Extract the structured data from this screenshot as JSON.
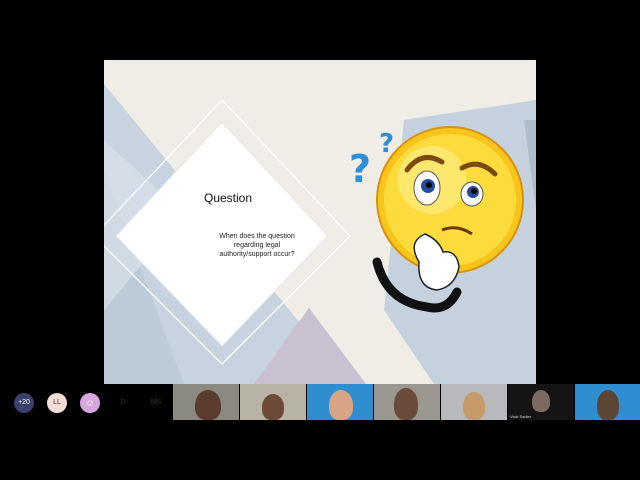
{
  "slide": {
    "title": "Question",
    "body": "When does the question regarding legal authority/support occur?",
    "emoji_icon": "thinking-face-with-question-marks"
  },
  "participants": {
    "overflow_count": "+20",
    "avatars": [
      {
        "label": "LL",
        "color": "#f3ddd6"
      },
      {
        "label": "",
        "color": "#d9a7df"
      },
      {
        "label": "D",
        "color": "#e6eef2"
      },
      {
        "label": "MS",
        "color": "#f6d8d8"
      }
    ],
    "video_tiles": [
      {
        "name": ""
      },
      {
        "name": ""
      },
      {
        "name": ""
      },
      {
        "name": ""
      },
      {
        "name": ""
      },
      {
        "name": "Vicki Sadler"
      },
      {
        "name": ""
      }
    ]
  }
}
